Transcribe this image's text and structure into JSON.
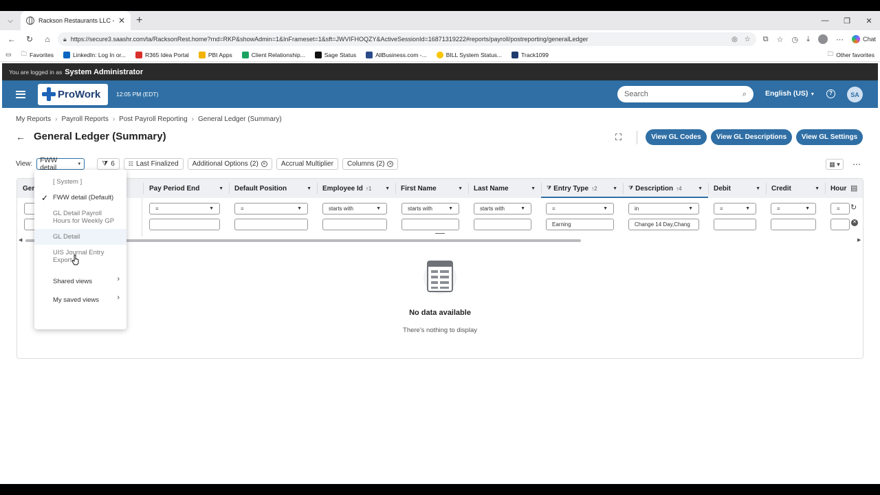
{
  "browser": {
    "tab_title": "Rackson Restaurants LLC - My Rep",
    "url": "https://secure3.saashr.com/ta/RacksonRest.home?rnd=RKP&showAdmin=1&InFrameset=1&sft=JWVIFHOQZY&ActiveSessionId=16871319222#reports/payroll/postreporting/generalLedger",
    "chat_label": "Chat",
    "favorites": [
      "Favorites",
      "LinkedIn: Log In or...",
      "R365 Idea Portal",
      "PBI Apps",
      "Client Relationship...",
      "Sage Status",
      "AllBusiness.com -...",
      "BILL System Status...",
      "Track1099"
    ],
    "other_favorites": "Other favorites"
  },
  "session": {
    "logged_prefix": "You are logged in as",
    "user_role": "System Administrator"
  },
  "topbar": {
    "logo": "ProWork",
    "time": "12:05 PM (EDT)",
    "search_placeholder": "Search",
    "language": "English (US)",
    "user_initials": "SA"
  },
  "breadcrumb": [
    "My Reports",
    "Payroll Reports",
    "Post Payroll Reporting",
    "General Ledger (Summary)"
  ],
  "page": {
    "title": "General Ledger (Summary)",
    "buttons": [
      "View GL Codes",
      "View GL Descriptions",
      "View GL Settings"
    ]
  },
  "toolbar": {
    "view_label": "View:",
    "view_value": "FWW detail",
    "filter_count": "6",
    "chips": [
      "Last Finalized",
      "Additional Options (2)",
      "Accrual Multiplier",
      "Columns (2)"
    ]
  },
  "grid": {
    "columns": [
      {
        "label": "Ger",
        "filter": "",
        "value": ""
      },
      {
        "label": "Pay Period End",
        "filter": "=",
        "value": ""
      },
      {
        "label": "Default Position",
        "filter": "=",
        "value": ""
      },
      {
        "label": "Employee Id",
        "sort": "↑1",
        "filter": "starts with",
        "value": ""
      },
      {
        "label": "First Name",
        "filter": "starts with",
        "value": ""
      },
      {
        "label": "Last Name",
        "filter": "starts with",
        "value": ""
      },
      {
        "label": "Entry Type",
        "sort": "↑2",
        "filtered": true,
        "filter": "=",
        "value": "Earning"
      },
      {
        "label": "Description",
        "sort": "↑4",
        "filtered": true,
        "filter": "in",
        "value": "Change 14 Day,Chang"
      },
      {
        "label": "Debit",
        "filter": "=",
        "value": ""
      },
      {
        "label": "Credit",
        "filter": "=",
        "value": ""
      },
      {
        "label": "Hour",
        "filter": "=",
        "value": ""
      }
    ],
    "empty_title": "No data available",
    "empty_subtitle": "There's nothing to display"
  },
  "view_menu": {
    "items": [
      {
        "label": "[ System ]",
        "dim": true
      },
      {
        "label": "FWW detail (Default)",
        "checked": true
      },
      {
        "label": "GL Detail Payroll Hours for Weekly GP",
        "dim": true
      },
      {
        "label": "GL Detail",
        "dim": true,
        "hover": true
      },
      {
        "label": "UIS Journal Entry Export",
        "dim": true
      },
      {
        "label": "Shared views",
        "submenu": true
      },
      {
        "label": "My saved views",
        "submenu": true
      }
    ]
  },
  "colors": {
    "primary": "#2f6fa5",
    "header_bg": "#2a2a2a"
  }
}
